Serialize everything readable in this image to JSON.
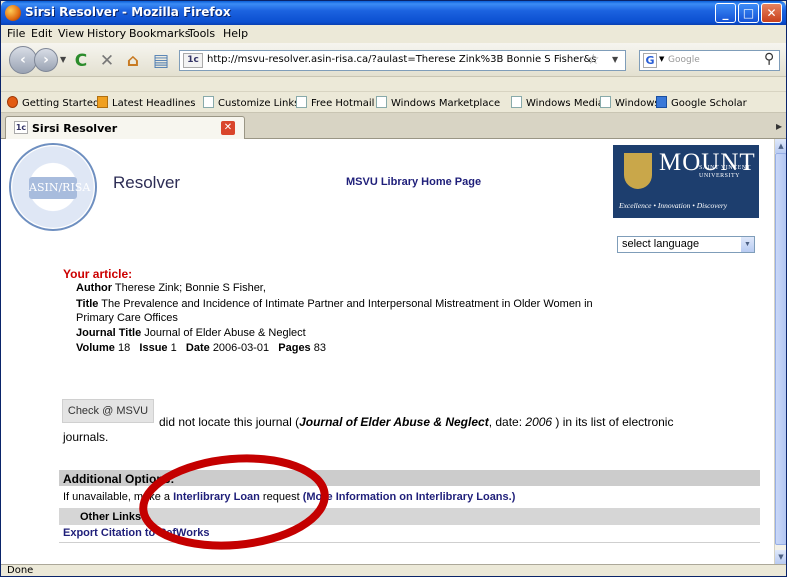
{
  "window": {
    "title": "Sirsi Resolver - Mozilla Firefox"
  },
  "menu": {
    "file": "File",
    "edit": "Edit",
    "view": "View",
    "history": "History",
    "bookmarks": "Bookmarks",
    "tools": "Tools",
    "help": "Help"
  },
  "nav": {
    "url": "http://msvu-resolver.asin-risa.ca/?aulast=Therese Zink%3B Bonnie S Fisher&sp",
    "site_icon": "1c",
    "search_engine_glyph": "G",
    "search_placeholder": "Google"
  },
  "bookmarks": [
    "Getting Started",
    "Latest Headlines",
    "Customize Links",
    "Free Hotmail",
    "Windows Marketplace",
    "Windows Media",
    "Windows",
    "Google Scholar"
  ],
  "tab": {
    "label": "Sirsi Resolver",
    "icon_text": "1c"
  },
  "page": {
    "logo_text": "ASIN/RISA",
    "resolver_title": "Resolver",
    "library_link": "MSVU Library Home Page",
    "msvu_logo": {
      "word": "MOUNT",
      "sub1": "SAINT VINCENT",
      "sub2": "UNIVERSITY",
      "tagline": "Excellence • Innovation • Discovery"
    },
    "language_select": "select language",
    "your_article": "Your article:",
    "article": {
      "author_label": "Author",
      "author": "Therese Zink; Bonnie S Fisher,",
      "title_label": "Title",
      "title_line1": "The Prevalence and Incidence of Intimate Partner and Interpersonal Mistreatment in Older Women in",
      "title_line2": "Primary Care Offices",
      "journal_label": "Journal Title",
      "journal": "Journal of Elder Abuse & Neglect",
      "volume_label": "Volume",
      "volume": "18",
      "issue_label": "Issue",
      "issue": "1",
      "date_label": "Date",
      "date": "2006-03-01",
      "pages_label": "Pages",
      "pages": "83"
    },
    "check_button": "Check @ MSVU",
    "notice": {
      "pre": "did not locate this journal (",
      "journal": "Journal of Elder Abuse & Neglect",
      "mid": ", date: ",
      "date": "2006",
      "post": " ) in its list of electronic",
      "line2": "journals."
    },
    "additional_options": "Additional Options:",
    "ill": {
      "pre": "If unavailable, make a ",
      "link": "Interlibrary Loan",
      "mid": " request ",
      "info_link": "(More Information on Interlibrary Loans.)"
    },
    "other_links": "Other Links",
    "export_citation": "Export Citation to RefWorks"
  },
  "status": {
    "text": "Done"
  },
  "colors": {
    "article_heading": "#cc0000",
    "link": "#1f1f7a",
    "annotation": "#c40000"
  }
}
